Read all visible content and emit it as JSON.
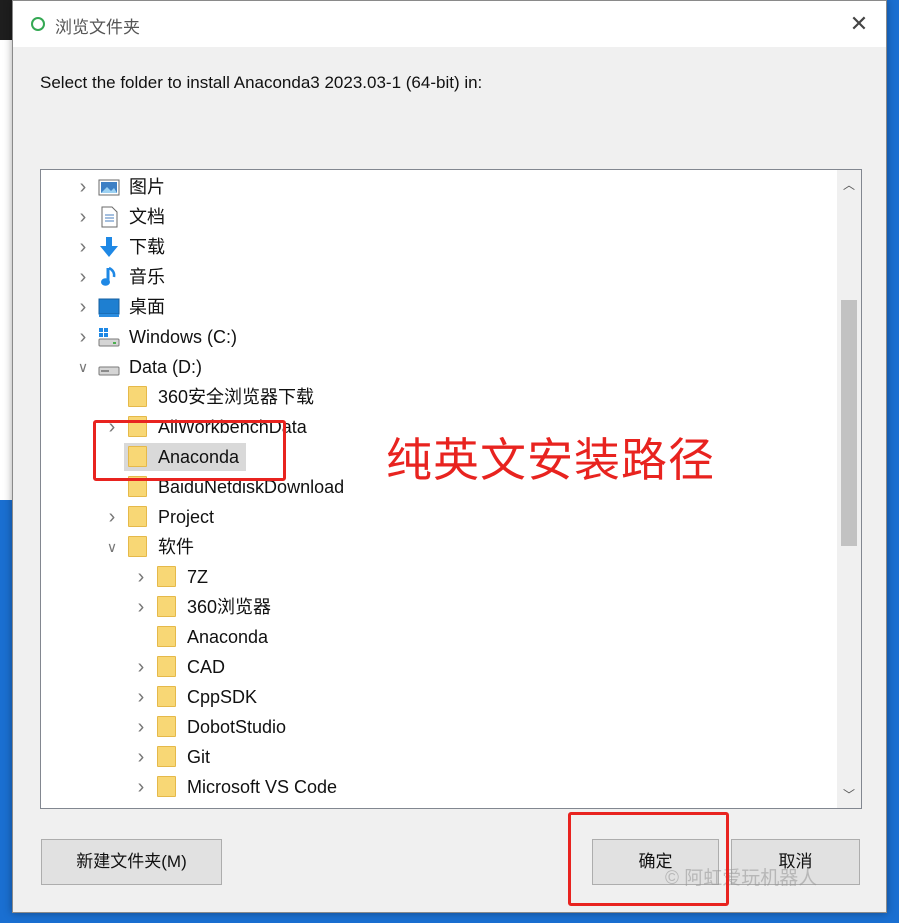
{
  "dialog": {
    "title": "浏览文件夹",
    "close_glyph": "✕",
    "prompt": "Select the folder to install Anaconda3 2023.03-1 (64-bit) in:",
    "buttons": {
      "new_folder": "新建文件夹(M)",
      "ok": "确定",
      "cancel": "取消"
    }
  },
  "tree": {
    "items": [
      {
        "label": "图片",
        "icon": "pictures-icon",
        "expander": "collapsed",
        "level": 0
      },
      {
        "label": "文档",
        "icon": "documents-icon",
        "expander": "collapsed",
        "level": 0
      },
      {
        "label": "下载",
        "icon": "downloads-icon",
        "expander": "collapsed",
        "level": 0
      },
      {
        "label": "音乐",
        "icon": "music-icon",
        "expander": "collapsed",
        "level": 0
      },
      {
        "label": "桌面",
        "icon": "desktop-icon",
        "expander": "collapsed",
        "level": 0
      },
      {
        "label": "Windows (C:)",
        "icon": "windows-drive-icon",
        "expander": "collapsed",
        "level": 0
      },
      {
        "label": "Data (D:)",
        "icon": "drive-icon",
        "expander": "expanded",
        "level": 0
      },
      {
        "label": "360安全浏览器下载",
        "icon": "folder-icon",
        "expander": "none",
        "level": 1
      },
      {
        "label": "AliWorkbenchData",
        "icon": "folder-icon",
        "expander": "collapsed",
        "level": 1
      },
      {
        "label": "Anaconda",
        "icon": "folder-icon",
        "expander": "none",
        "level": 1,
        "selected": true
      },
      {
        "label": "BaiduNetdiskDownload",
        "icon": "folder-icon",
        "expander": "none",
        "level": 1
      },
      {
        "label": "Project",
        "icon": "folder-icon",
        "expander": "collapsed",
        "level": 1
      },
      {
        "label": "软件",
        "icon": "folder-icon",
        "expander": "expanded",
        "level": 1
      },
      {
        "label": "7Z",
        "icon": "folder-icon",
        "expander": "collapsed",
        "level": 2
      },
      {
        "label": "360浏览器",
        "icon": "folder-icon",
        "expander": "collapsed",
        "level": 2
      },
      {
        "label": "Anaconda",
        "icon": "folder-icon",
        "expander": "none",
        "level": 2
      },
      {
        "label": "CAD",
        "icon": "folder-icon",
        "expander": "collapsed",
        "level": 2
      },
      {
        "label": "CppSDK",
        "icon": "folder-icon",
        "expander": "collapsed",
        "level": 2
      },
      {
        "label": "DobotStudio",
        "icon": "folder-icon",
        "expander": "collapsed",
        "level": 2
      },
      {
        "label": "Git",
        "icon": "folder-icon",
        "expander": "collapsed",
        "level": 2
      },
      {
        "label": "Microsoft VS Code",
        "icon": "folder-icon",
        "expander": "collapsed",
        "level": 2
      }
    ]
  },
  "annotation": {
    "text": "纯英文安装路径",
    "color": "#e8231f"
  },
  "watermark": "© 阿虹爱玩机器人",
  "colors": {
    "dialog_bg": "#f0f0f0",
    "selection": "#d9d9d9",
    "folder": "#f8d775",
    "accent_blue": "#1e88e5"
  }
}
